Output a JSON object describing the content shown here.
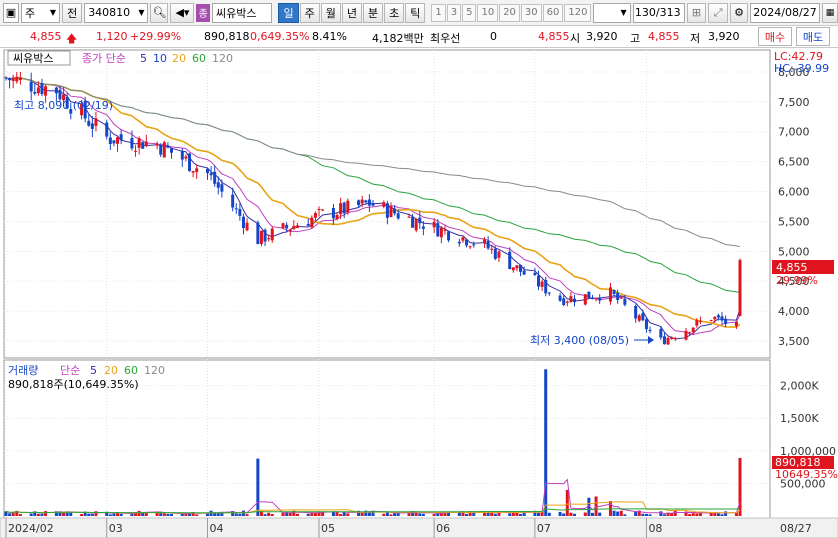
{
  "toolbar": {
    "mode_label": "주",
    "prefix_label": "전",
    "stock_code": "340810",
    "badge_label": "종",
    "stock_name": "씨유박스",
    "period_buttons": [
      "일",
      "주",
      "월",
      "년",
      "분",
      "초",
      "틱"
    ],
    "active_period": "일",
    "interval_buttons": [
      "1",
      "3",
      "5",
      "10",
      "20",
      "30",
      "60",
      "120"
    ],
    "view_count": "130/313",
    "date": "2024/08/27"
  },
  "quote": {
    "price": "4,855",
    "change": "1,120",
    "change_pct": "+29.99%",
    "volume": "890,818",
    "volume_pct": "0,649.35%",
    "turnover": "8.41%",
    "amount": "4,182백만",
    "broker_label": "최우선",
    "broker_value": "0",
    "ask": "4,855",
    "open_label": "시",
    "open": "3,920",
    "high_label": "고",
    "high": "4,855",
    "low_label": "저",
    "low": "3,920",
    "buy_label": "매수",
    "sell_label": "매도"
  },
  "price_panel": {
    "name_tag": "씨유박스",
    "legend_prefix": "종가 단순",
    "ma_labels": [
      "5",
      "10",
      "20",
      "60",
      "120"
    ],
    "lc": "LC:42.79",
    "hc": "HC:-39.99",
    "high_note": "최고 8,090 (02/19)",
    "low_note": "최저 3,400 (08/05)",
    "current_price": "4,855",
    "current_pct": "29.99%"
  },
  "volume_panel": {
    "legend_prefix": "거래량",
    "legend_simple": "단순",
    "ma_labels": [
      "5",
      "20",
      "60",
      "120"
    ],
    "current_line": "890,818주(10,649.35%)",
    "current_volume": "890,818",
    "current_pct": "10649.35%"
  },
  "x_axis": {
    "ticks": [
      {
        "date": "2024-02-05",
        "label": "2024/02"
      },
      {
        "date": "2024-03-04",
        "label": "03"
      },
      {
        "date": "2024-04-01",
        "label": "04"
      },
      {
        "date": "2024-05-02",
        "label": "05"
      },
      {
        "date": "2024-06-03",
        "label": "06"
      },
      {
        "date": "2024-07-01",
        "label": "07"
      },
      {
        "date": "2024-08-01",
        "label": "08"
      },
      {
        "date": "2024-08-27",
        "label": "08/27"
      }
    ]
  },
  "colors": {
    "up": "#e0141e",
    "down": "#1446c8",
    "ma5": "#3a2aa8",
    "ma10": "#c040c0",
    "ma20": "#e8a317",
    "ma60": "#2aa53a",
    "ma120": "#8a8a8a"
  },
  "chart_data": [
    {
      "type": "candlestick",
      "title": "씨유박스",
      "y_ticks": [
        3500,
        4000,
        4500,
        5000,
        5500,
        6000,
        6500,
        7000,
        7500,
        8000
      ],
      "ylim": [
        3250,
        8300
      ],
      "x_dates": [
        "2024-02-05",
        "2024-08-27"
      ],
      "close_series_approx": [
        {
          "date": "2024-02-05",
          "close": 7900
        },
        {
          "date": "2024-02-19",
          "close": 7700
        },
        {
          "date": "2024-03-04",
          "close": 6900
        },
        {
          "date": "2024-03-18",
          "close": 6800
        },
        {
          "date": "2024-04-01",
          "close": 6300
        },
        {
          "date": "2024-04-15",
          "close": 5200
        },
        {
          "date": "2024-05-02",
          "close": 5600
        },
        {
          "date": "2024-05-16",
          "close": 5800
        },
        {
          "date": "2024-06-03",
          "close": 5400
        },
        {
          "date": "2024-06-17",
          "close": 5100
        },
        {
          "date": "2024-07-01",
          "close": 4500
        },
        {
          "date": "2024-07-08",
          "close": 4200
        },
        {
          "date": "2024-07-22",
          "close": 4300
        },
        {
          "date": "2024-08-05",
          "close": 3500
        },
        {
          "date": "2024-08-19",
          "close": 3900
        },
        {
          "date": "2024-08-26",
          "close": 3735
        },
        {
          "date": "2024-08-27",
          "close": 4855
        }
      ],
      "extremes": [
        {
          "label": "최고",
          "date": "2024-02-19",
          "value": 8090
        },
        {
          "label": "최저",
          "date": "2024-08-05",
          "value": 3400
        }
      ],
      "last_candle": {
        "date": "2024-08-27",
        "open": 3920,
        "high": 4855,
        "low": 3920,
        "close": 4855
      }
    },
    {
      "type": "bar",
      "title": "거래량",
      "y_ticks": [
        500000,
        1000000,
        1500000,
        2000000
      ],
      "y_tick_labels": [
        "500,000",
        "1,000,000",
        "1,500,000",
        "2,000,000",
        "2,000K"
      ],
      "y_tick_labels_display": [
        "500,000",
        "1,000,000",
        "1,500K",
        "2,000K"
      ],
      "ylim": [
        0,
        2300000
      ],
      "spikes_approx": [
        {
          "date": "2024-04-15",
          "value": 880000
        },
        {
          "date": "2024-07-04",
          "value": 2250000
        },
        {
          "date": "2024-07-10",
          "value": 400000
        },
        {
          "date": "2024-07-16",
          "value": 280000
        },
        {
          "date": "2024-07-18",
          "value": 300000
        },
        {
          "date": "2024-07-22",
          "value": 230000
        },
        {
          "date": "2024-08-27",
          "value": 890818
        }
      ],
      "base_volume_approx": 60000
    }
  ]
}
